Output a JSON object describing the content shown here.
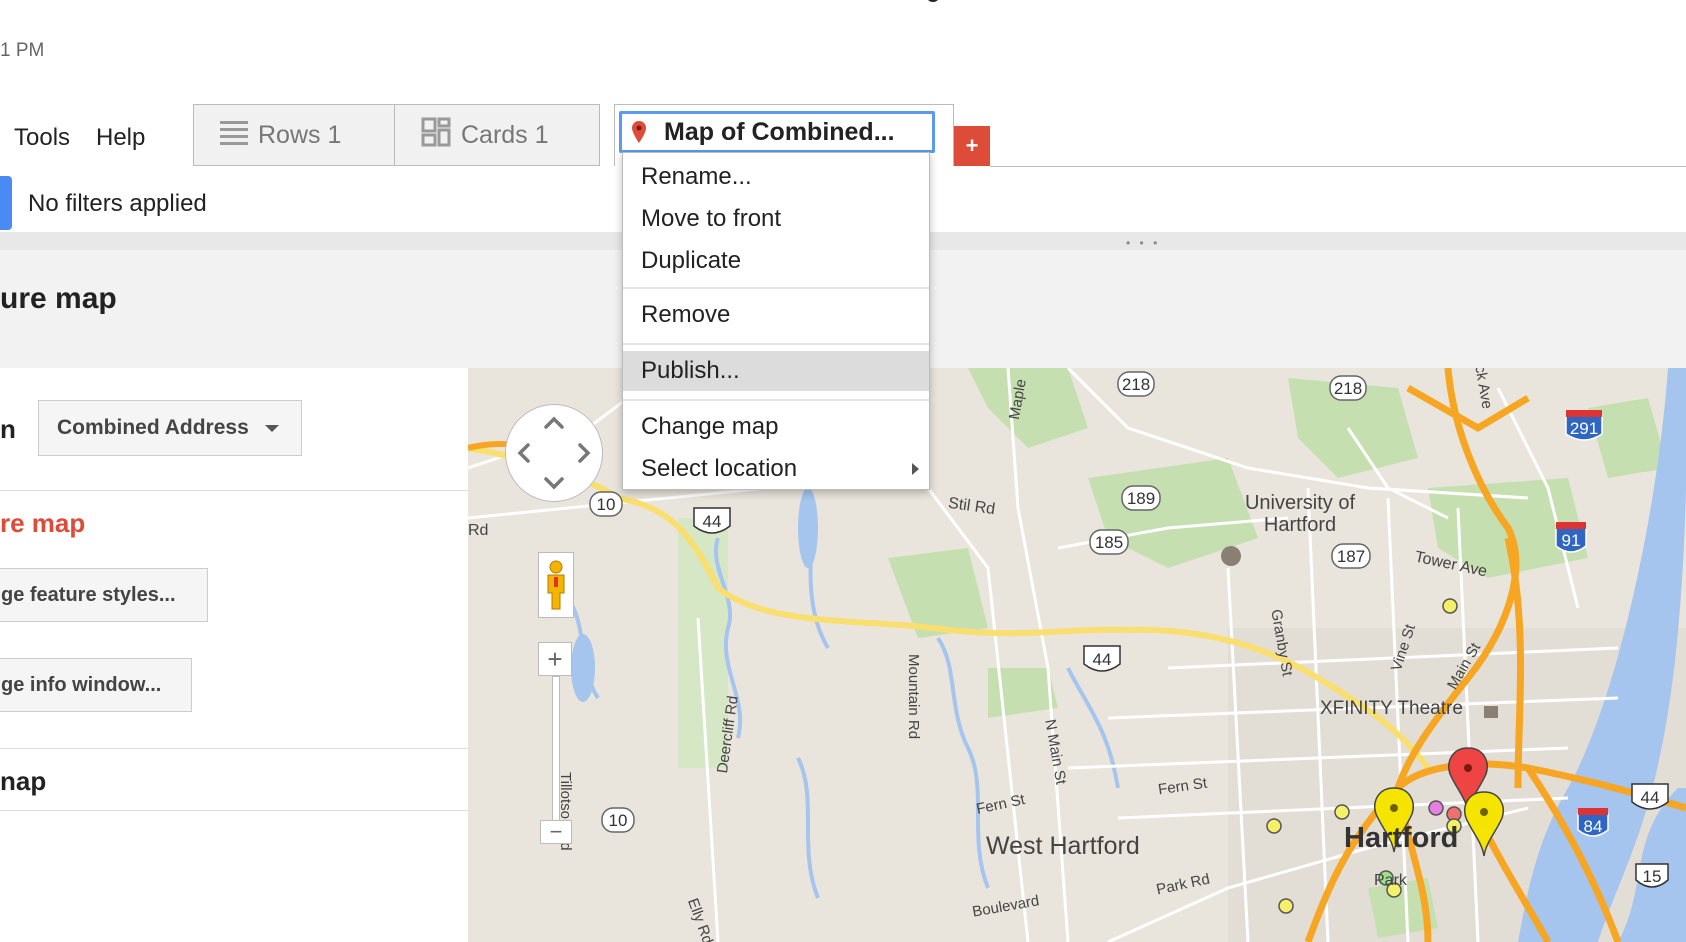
{
  "header": {
    "timestamp": "1 PM"
  },
  "menubar": {
    "tools": "Tools",
    "help": "Help"
  },
  "tabs": [
    {
      "label": "Rows 1",
      "icon": "rows-icon"
    },
    {
      "label": "Cards 1",
      "icon": "cards-icon"
    },
    {
      "label": "Map of Combined...",
      "icon": "map-pin-icon",
      "active": true
    }
  ],
  "add_tab": {
    "label": "+",
    "color": "#dd4b39"
  },
  "filter": {
    "text": "No filters applied",
    "accent_color": "#4a8af4"
  },
  "panel": {
    "title": "ure map",
    "location_label": "n",
    "location_value": "Combined Address",
    "feature_map_heading": "re map",
    "feature_styles_button": "ge feature styles...",
    "info_window_button": "ge info window...",
    "map_heading": "nap"
  },
  "context_menu": {
    "items": [
      {
        "label": "Rename..."
      },
      {
        "label": "Move to front"
      },
      {
        "label": "Duplicate"
      },
      {
        "label": "Remove"
      },
      {
        "label": "Publish...",
        "highlighted": true
      },
      {
        "label": "Change map"
      },
      {
        "label": "Select location",
        "submenu": true
      }
    ]
  },
  "map": {
    "places": {
      "university": "University of Hartford",
      "xfinity": "XFINITY Theatre",
      "west_hartford": "West Hartford",
      "hartford": "Hartford",
      "park": "Park"
    },
    "streets": {
      "maple": "Maple",
      "stil_rd": "Stil Rd",
      "rd_left": "Rd",
      "tower_ave": "Tower Ave",
      "granby_st": "Granby St",
      "vine_st": "Vine St",
      "main_st": "Main St",
      "deercliff": "Deercliff Rd",
      "mountain": "Mountain Rd",
      "n_main": "N Main St",
      "fern_st_1": "Fern St",
      "fern_st_2": "Fern St",
      "tillotson": "Tillotson Rd",
      "boulevard": "Boulevard",
      "park_rd": "Park Rd",
      "elly_rd": "Elly Rd",
      "ck_ave": "ck Ave"
    },
    "shields": [
      "218",
      "218",
      "291",
      "10",
      "44",
      "189",
      "185",
      "187",
      "91",
      "44",
      "10",
      "44",
      "84",
      "15"
    ],
    "colors": {
      "water": "#a5c4ee",
      "park": "#c6dfb0",
      "highway": "#f6a623",
      "arterial": "#f8df6f"
    }
  }
}
